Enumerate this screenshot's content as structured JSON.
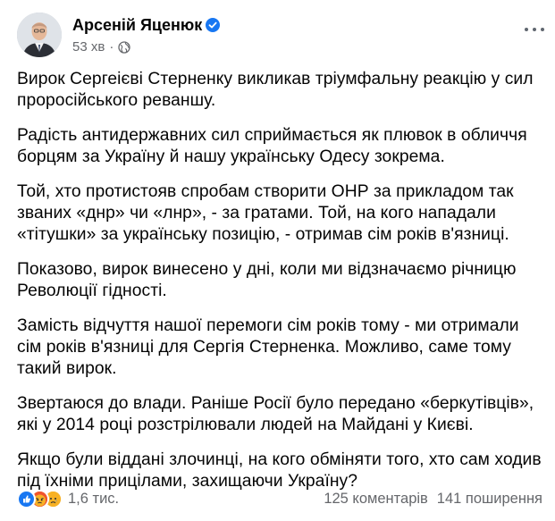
{
  "post": {
    "author": {
      "name": "Арсеній Яценюк",
      "verified": true
    },
    "time": "53 хв",
    "separator": "·",
    "privacy_icon": "globe-icon",
    "more_icon": "more-options-icon",
    "paragraphs": [
      "Вирок Сергеієві Стерненку викликав тріумфальну реакцію у сил проросійського реваншу.",
      "Радість антидержавних сил сприймається як плювок в обличчя борцям за Україну й нашу українську Одесу зокрема.",
      "Той, хто протистояв спробам створити ОНР за прикладом так званих «днр» чи «лнр», - за гратами. Той, на кого нападали «тітушки» за українську позицію, - отримав сім років в'язниці.",
      "Показово, вирок винесено у дні, коли ми відзначаємо річницю Революції гідності.",
      "Замість відчуття нашої перемоги сім років тому - ми отримали сім років в'язниці для Сергія Стерненка. Можливо, саме тому такий вирок.",
      "Звертаюся до влади. Раніше Росії було передано «беркутівців», які у 2014 році розстрілювали людей на Майдані у Києві.",
      "Якщо були віддані злочинці, на кого обміняти того, хто сам ходив під їхніми прицілами, захищаючи Україну?"
    ],
    "reactions": {
      "icons": [
        "like-icon",
        "angry-icon",
        "sad-icon"
      ],
      "count": "1,6 тис."
    },
    "comments": "125 коментарів",
    "shares": "141 поширення"
  },
  "colors": {
    "verified": "#1877f2",
    "secondary_text": "#65676b",
    "like": "#1877f2",
    "angry": "#e9710f",
    "sad": "#f7b125"
  }
}
